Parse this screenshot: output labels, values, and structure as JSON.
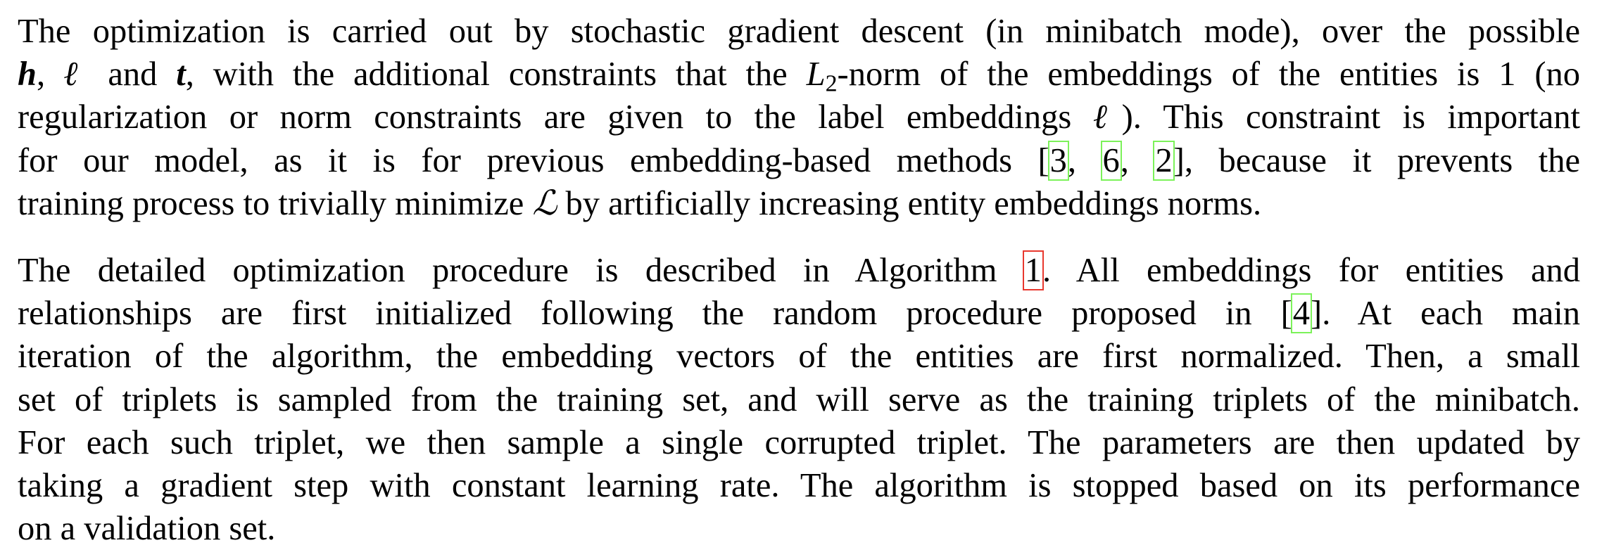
{
  "paragraph1": {
    "l1": "The optimization is carried out by stochastic gradient descent (in minibatch mode), over the possible",
    "l2": {
      "h": "h",
      "comma1": ",",
      "ell": "ℓ",
      "and": " and ",
      "t": "t",
      "rest1": ", with the additional constraints that the ",
      "L": "L",
      "sub": "2",
      "rest2": "-norm of the embeddings of the entities is 1 (no"
    },
    "l3": {
      "a": "regularization or norm constraints are given to the label embeddings ",
      "ell": "ℓ",
      "b": "). This constraint is important"
    },
    "l4": {
      "a": "for our model, as it is for previous embedding-based methods [",
      "c1": "3",
      "s1": ", ",
      "c2": "6",
      "s2": ", ",
      "c3": "2",
      "b": "], because it prevents the"
    },
    "l5": {
      "a": "training process to trivially minimize ",
      "loss": "ℒ",
      "b": " by artificially increasing entity embeddings norms."
    }
  },
  "paragraph2": {
    "l1": {
      "a": "The detailed optimization procedure is described in Algorithm ",
      "alg": "1",
      "b": ". All embeddings for entities and"
    },
    "l2": {
      "a": "relationships are first initialized following the random procedure proposed in [",
      "c": "4",
      "b": "]. At each main"
    },
    "l3": "iteration of the algorithm, the embedding vectors of the entities are first normalized. Then, a small",
    "l4": "set of triplets is sampled from the training set, and will serve as the training triplets of the minibatch.",
    "l5": "For each such triplet, we then sample a single corrupted triplet. The parameters are then updated by",
    "l6": "taking a gradient step with constant learning rate. The algorithm is stopped based on its performance",
    "l7": "on a validation set."
  },
  "colors": {
    "citation_box": "#7cf25a",
    "algorithm_ref_box": "#e8382e"
  }
}
